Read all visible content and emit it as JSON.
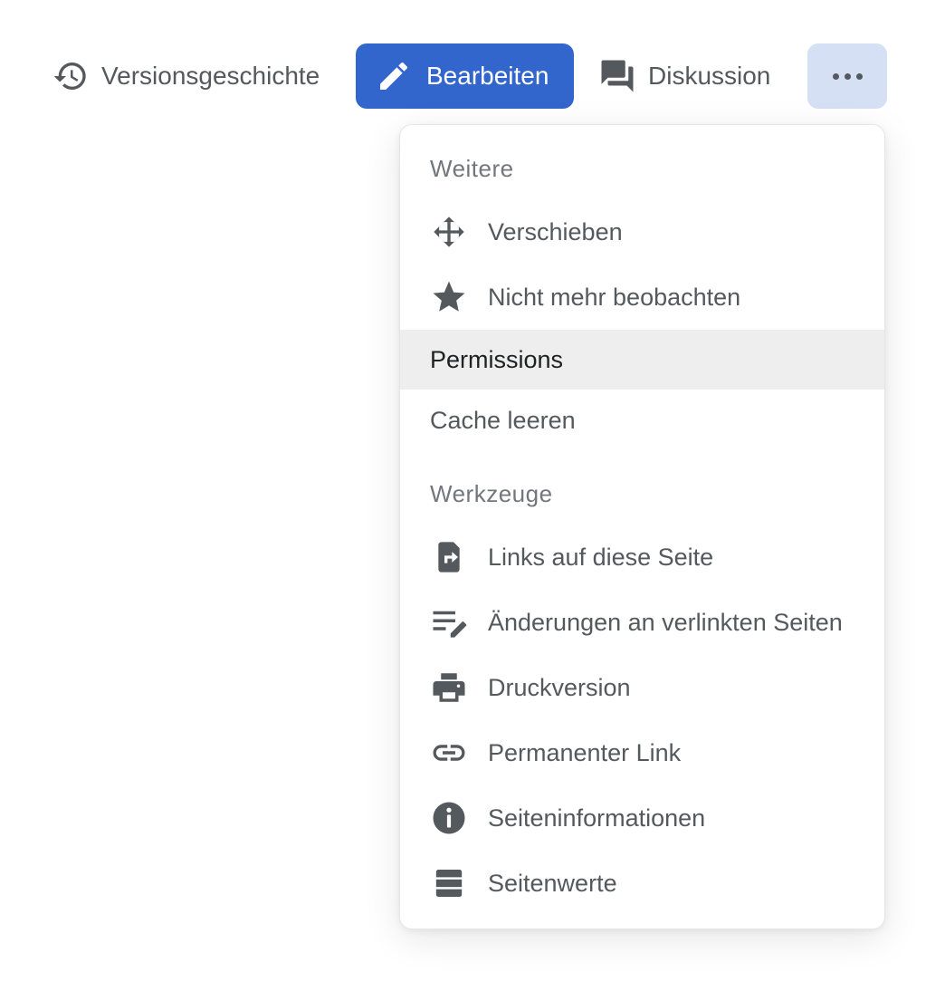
{
  "actions": {
    "history": {
      "label": "Versionsgeschichte",
      "icon": "history-icon"
    },
    "edit": {
      "label": "Bearbeiten",
      "icon": "pencil-icon"
    },
    "talk": {
      "label": "Diskussion",
      "icon": "discussion-icon"
    },
    "more": {
      "icon": "ellipsis-icon"
    }
  },
  "menu": {
    "section1": {
      "heading": "Weitere",
      "items": [
        {
          "label": "Verschieben",
          "icon": "move-icon"
        },
        {
          "label": "Nicht mehr beobachten",
          "icon": "star-icon"
        },
        {
          "label": "Permissions",
          "icon": ""
        },
        {
          "label": "Cache leeren",
          "icon": ""
        }
      ]
    },
    "section2": {
      "heading": "Werkzeuge",
      "items": [
        {
          "label": "Links auf diese Seite",
          "icon": "link-in-icon"
        },
        {
          "label": "Änderungen an verlinkten Seiten",
          "icon": "related-changes-icon"
        },
        {
          "label": "Druckversion",
          "icon": "printer-icon"
        },
        {
          "label": "Permanenter Link",
          "icon": "link-icon"
        },
        {
          "label": "Seiteninformationen",
          "icon": "info-icon"
        },
        {
          "label": "Seitenwerte",
          "icon": "database-icon"
        }
      ]
    }
  },
  "colors": {
    "primary": "#3366cc",
    "more_button_bg": "#d6e0f5",
    "text": "#54595d",
    "muted": "#72777d",
    "highlight_bg": "#eeeeee"
  }
}
